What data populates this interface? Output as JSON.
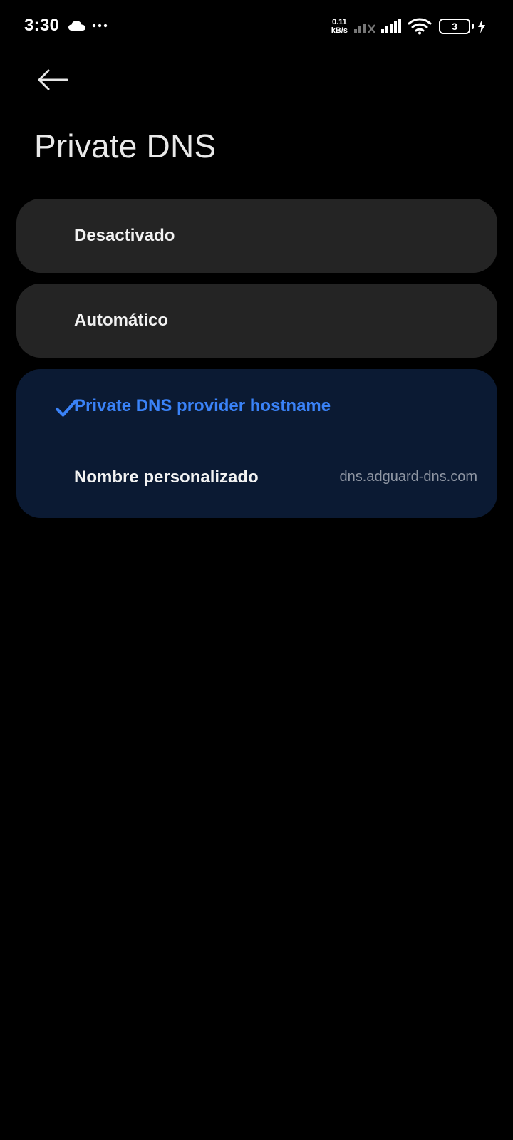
{
  "status_bar": {
    "time": "3:30",
    "net_speed_value": "0.11",
    "net_speed_unit": "kB/s",
    "battery_level": "3"
  },
  "header": {
    "title": "Private DNS"
  },
  "options": {
    "off_label": "Desactivado",
    "auto_label": "Automático",
    "hostname_label": "Private DNS provider hostname",
    "custom_label": "Nombre personalizado",
    "custom_value": "dns.adguard-dns.com",
    "selected": "hostname"
  },
  "colors": {
    "background": "#000000",
    "card": "#242424",
    "selected_card": "#0b1a33",
    "accent": "#3a82f7",
    "secondary_text": "#8f96a3"
  },
  "icons": {
    "back": "arrow-left-icon",
    "check": "checkmark-icon",
    "cloud": "cloud-icon",
    "more": "more-dots-icon",
    "signal": "signal-icon",
    "wifi": "wifi-icon",
    "battery": "battery-icon",
    "charging": "bolt-icon"
  }
}
